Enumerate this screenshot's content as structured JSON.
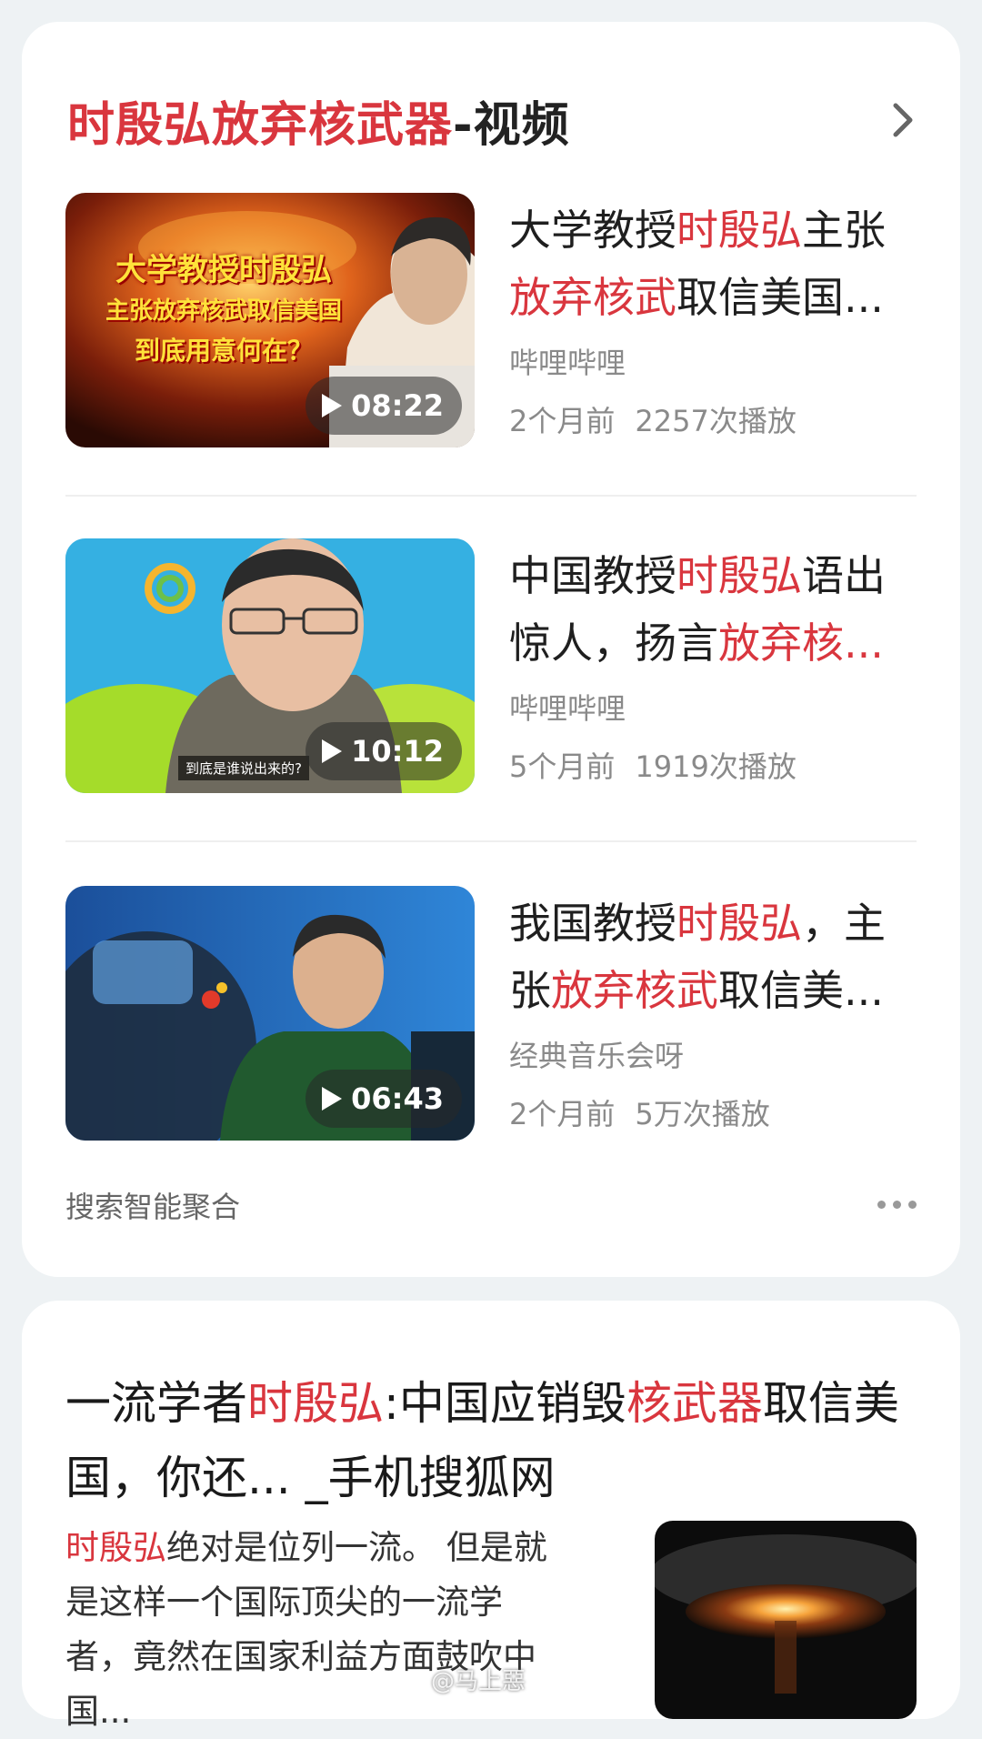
{
  "video_card": {
    "title_hl": "时殷弘放弃核武器",
    "title_rest": "-视频",
    "videos": [
      {
        "title_parts": [
          {
            "t": "大学教授",
            "hl": false
          },
          {
            "t": "时殷弘",
            "hl": true
          },
          {
            "t": "主张",
            "hl": false
          },
          {
            "t": "放弃核武",
            "hl": true
          },
          {
            "t": "取信美国...",
            "hl": false
          }
        ],
        "source": "哔哩哔哩",
        "time_ago": "2个月前",
        "plays": "2257次播放",
        "duration": "08:22",
        "thumb_caption_lines": [
          "大学教授时殷弘",
          "主张放弃核武取信美国",
          "到底用意何在？"
        ]
      },
      {
        "title_parts": [
          {
            "t": "中国教授",
            "hl": false
          },
          {
            "t": "时殷弘",
            "hl": true
          },
          {
            "t": "语出惊人，扬言",
            "hl": false
          },
          {
            "t": "放弃核...",
            "hl": true
          }
        ],
        "source": "哔哩哔哩",
        "time_ago": "5个月前",
        "plays": "1919次播放",
        "duration": "10:12",
        "thumb_subtitle": "到底是谁说出来的?"
      },
      {
        "title_parts": [
          {
            "t": "我国教授",
            "hl": false
          },
          {
            "t": "时殷弘",
            "hl": true
          },
          {
            "t": "，主张",
            "hl": false
          },
          {
            "t": "放弃核武",
            "hl": true
          },
          {
            "t": "取信美...",
            "hl": false
          }
        ],
        "source": "经典音乐会呀",
        "time_ago": "2个月前",
        "plays": "5万次播放",
        "duration": "06:43"
      }
    ],
    "footer_label": "搜索智能聚合"
  },
  "article_card": {
    "title_parts": [
      {
        "t": "一流学者",
        "hl": false
      },
      {
        "t": "时殷弘",
        "hl": true
      },
      {
        "t": ":中国应销毁",
        "hl": false
      },
      {
        "t": "核武器",
        "hl": true
      },
      {
        "t": "取信美国，你还... _手机搜狐网",
        "hl": false
      }
    ],
    "snippet_parts": [
      {
        "t": "时殷弘",
        "hl": true
      },
      {
        "t": "绝对是位列一流。 但是就是这样一个国际顶尖的一流学者，竟然在国家利益方面鼓吹中国...",
        "hl": false
      }
    ],
    "watermark": "@马上惡"
  },
  "colors": {
    "highlight": "#d9363e",
    "page_bg": "#eef2f4",
    "card_bg": "#ffffff",
    "meta_text": "#8a8a8a"
  },
  "icons": [
    "chevron-right-icon",
    "play-icon",
    "more-dots-icon"
  ]
}
